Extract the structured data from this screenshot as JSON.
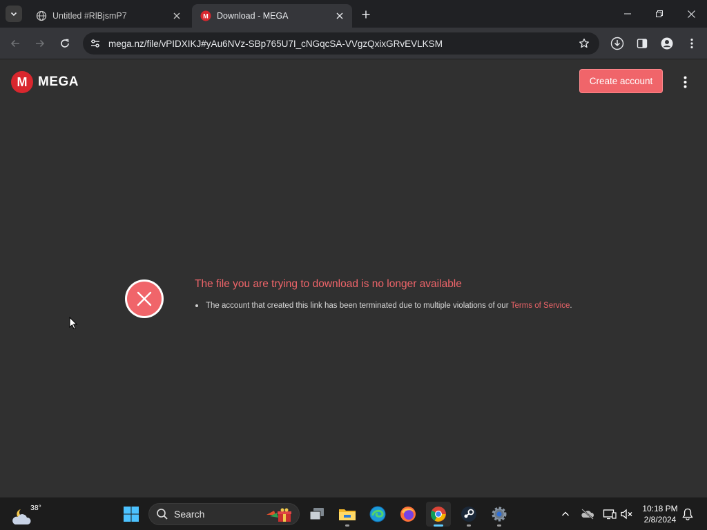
{
  "browser": {
    "tabs": [
      {
        "title": "Untitled #RlBjsmP7",
        "active": false
      },
      {
        "title": "Download - MEGA",
        "active": true
      }
    ],
    "url": "mega.nz/file/vPIDXIKJ#yAu6NVz-SBp765U7I_cNGqcSA-VVgzQxixGRvEVLKSM"
  },
  "page": {
    "logo_letter": "M",
    "logo_text": "MEGA",
    "create_account_label": "Create account",
    "error": {
      "title": "The file you are trying to download is no longer available",
      "message": "The account that created this link has been terminated due to multiple violations of our",
      "link_text": "Terms of Service",
      "trailing": "."
    }
  },
  "taskbar": {
    "temperature": "38°",
    "search_label": "Search",
    "time": "10:18 PM",
    "date": "2/8/2024"
  },
  "colors": {
    "accent": "#f0656a",
    "brand_red": "#d9272e",
    "page_bg": "#303030"
  }
}
